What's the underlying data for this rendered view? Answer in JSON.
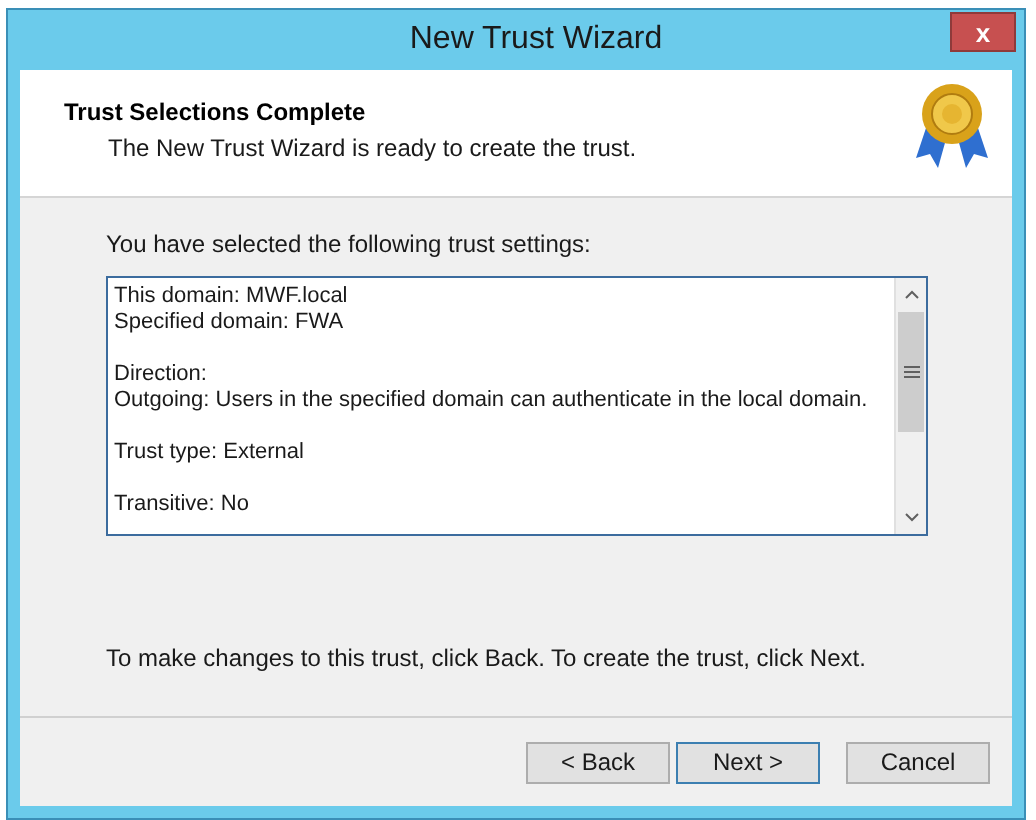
{
  "window": {
    "title": "New Trust Wizard",
    "close": "x"
  },
  "header": {
    "title": "Trust Selections Complete",
    "subtitle": "The New Trust Wizard is ready to create the trust."
  },
  "intro": "You have selected the following trust settings:",
  "settings": [
    [
      "This domain: MWF.local",
      "Specified domain: FWA"
    ],
    [
      "Direction:",
      "Outgoing: Users in the specified domain can authenticate in the local domain."
    ],
    [
      "Trust type: External"
    ],
    [
      "Transitive: No"
    ]
  ],
  "footer_text": "To make changes to this trust, click Back. To create the trust, click Next.",
  "buttons": [
    {
      "label": "< Back",
      "default": false
    },
    {
      "label": "Next >",
      "default": true
    },
    {
      "label": "Cancel",
      "default": false
    }
  ]
}
